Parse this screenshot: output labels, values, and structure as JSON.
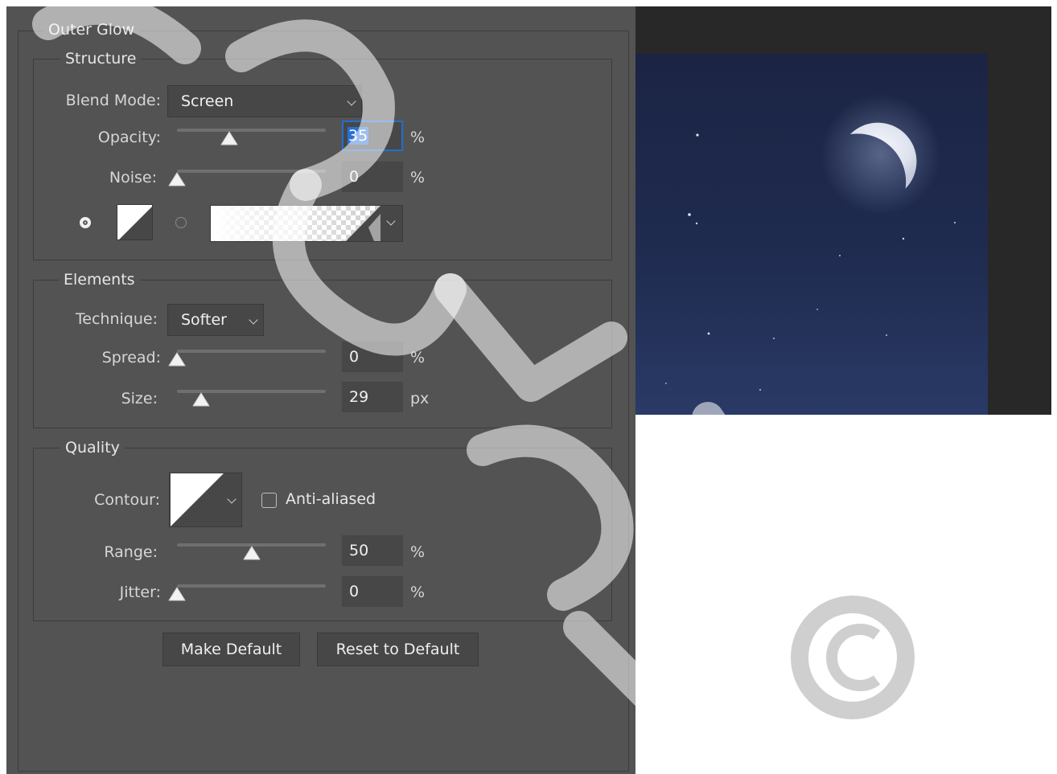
{
  "dialog": {
    "section_title": "Outer Glow",
    "structure": {
      "title": "Structure",
      "blend_mode_label": "Blend Mode:",
      "blend_mode_value": "Screen",
      "opacity_label": "Opacity:",
      "opacity_value": "35",
      "opacity_unit": "%",
      "opacity_slider_level": 0.35,
      "noise_label": "Noise:",
      "noise_value": "0",
      "noise_unit": "%",
      "noise_slider_level": 0.0,
      "color_mode": "solid-color",
      "glow_color": "#ffffff"
    },
    "elements": {
      "title": "Elements",
      "technique_label": "Technique:",
      "technique_value": "Softer",
      "spread_label": "Spread:",
      "spread_value": "0",
      "spread_unit": "%",
      "spread_slider_level": 0.0,
      "size_label": "Size:",
      "size_value": "29",
      "size_unit": "px",
      "size_slider_level": 0.16
    },
    "quality": {
      "title": "Quality",
      "contour_label": "Contour:",
      "anti_aliased_label": "Anti-aliased",
      "anti_aliased_checked": false,
      "range_label": "Range:",
      "range_value": "50",
      "range_unit": "%",
      "range_slider_level": 0.5,
      "jitter_label": "Jitter:",
      "jitter_value": "0",
      "jitter_unit": "%",
      "jitter_slider_level": 0.0
    },
    "buttons": {
      "make_default": "Make Default",
      "reset_to_default": "Reset to Default"
    }
  },
  "colors": {
    "panel_bg": "#535353",
    "field_bg": "#474747",
    "focus_accent": "#1f6fd3",
    "canvas_bg": "#282828",
    "sky_top": "#1b2444",
    "sky_bottom": "#2a3a66"
  },
  "icons": {
    "radio_solid": "radio-selected-icon",
    "radio_gradient": "radio-unselected-icon",
    "dropdown": "chevron-down-icon",
    "slider": "triangle-slider-thumb-icon",
    "contour": "linear-contour-icon"
  }
}
